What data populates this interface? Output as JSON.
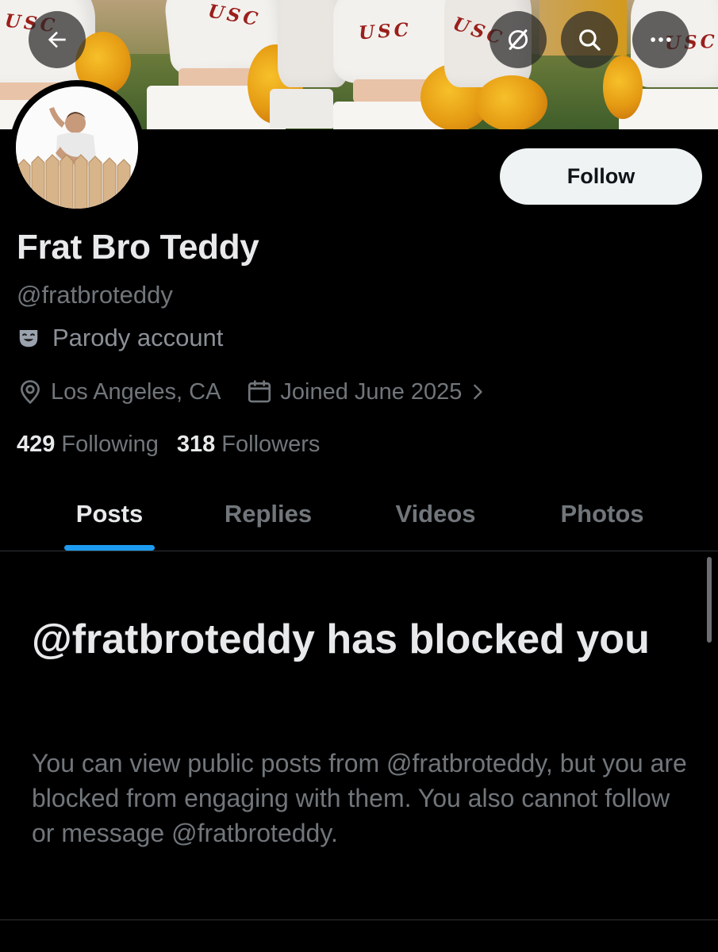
{
  "banner": {
    "jersey_text": "USC",
    "colors": {
      "jersey": "#f3f1ee",
      "pompom": "#e59b13",
      "lettering": "#9a1f1b",
      "field": "#3f5e2a"
    }
  },
  "header_buttons": {
    "back_icon": "arrow-left-icon",
    "grok_icon": "grok-slash-icon",
    "search_icon": "search-icon",
    "more_icon": "more-horizontal-icon"
  },
  "profile": {
    "display_name": "Frat Bro Teddy",
    "handle": "@fratbroteddy",
    "parody_label": "Parody account",
    "parody_icon": "theater-mask-icon",
    "location": "Los Angeles, CA",
    "location_icon": "location-pin-icon",
    "joined": "Joined June 2025",
    "joined_icon": "calendar-icon",
    "following_count": "429",
    "following_label": "Following",
    "followers_count": "318",
    "followers_label": "Followers"
  },
  "actions": {
    "follow_label": "Follow"
  },
  "tabs": [
    {
      "label": "Posts",
      "active": true
    },
    {
      "label": "Replies",
      "active": false
    },
    {
      "label": "Videos",
      "active": false
    },
    {
      "label": "Photos",
      "active": false
    }
  ],
  "blocked": {
    "title": "@fratbroteddy has blocked you",
    "body": "You can view public posts from @fratbroteddy, but you are blocked from engaging with them. You also cannot follow or message @fratbroteddy."
  },
  "theme": {
    "background": "#000000",
    "primary_text": "#e7e9ea",
    "secondary_text": "#71767b",
    "accent": "#1d9bf0",
    "divider": "#2f3336"
  }
}
